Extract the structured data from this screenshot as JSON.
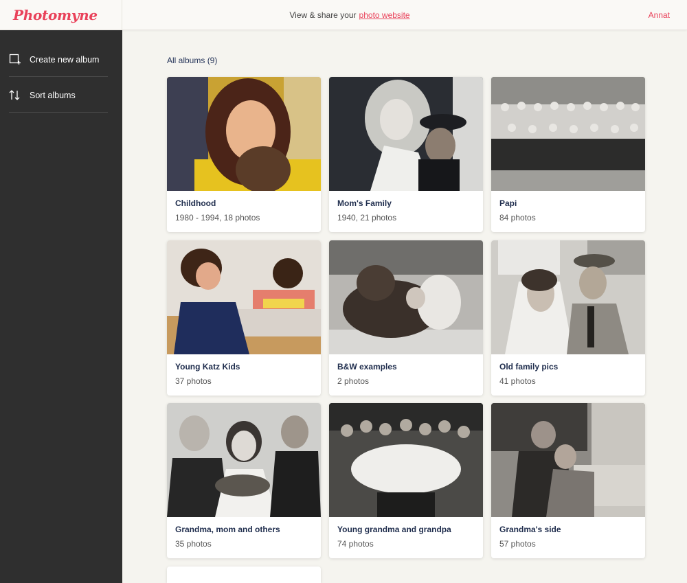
{
  "header": {
    "logo": "Photomyne",
    "tagline": "View & share your",
    "link": "photo website",
    "user": "Annat"
  },
  "sidebar": {
    "items": [
      {
        "label": "Create new album",
        "icon": "create-album-icon"
      },
      {
        "label": "Sort albums",
        "icon": "sort-icon"
      }
    ]
  },
  "main": {
    "title": "All albums (9)",
    "albums": [
      {
        "title": "Childhood",
        "subtitle": "1980 - 1994, 18 photos"
      },
      {
        "title": "Mom's Family",
        "subtitle": "1940, 21 photos"
      },
      {
        "title": "Papi",
        "subtitle": "84 photos"
      },
      {
        "title": "Young Katz Kids",
        "subtitle": "37 photos"
      },
      {
        "title": "B&W examples",
        "subtitle": "2 photos"
      },
      {
        "title": "Old family pics",
        "subtitle": "41 photos"
      },
      {
        "title": "Grandma, mom and others",
        "subtitle": "35 photos"
      },
      {
        "title": "Young grandma and grandpa",
        "subtitle": "74 photos"
      },
      {
        "title": "Grandma's side",
        "subtitle": "57 photos"
      }
    ]
  },
  "colors": {
    "accent": "#e9425a",
    "sidebar": "#2f2f2f",
    "background": "#f5f4ef",
    "title_text": "#1f2d4d"
  }
}
